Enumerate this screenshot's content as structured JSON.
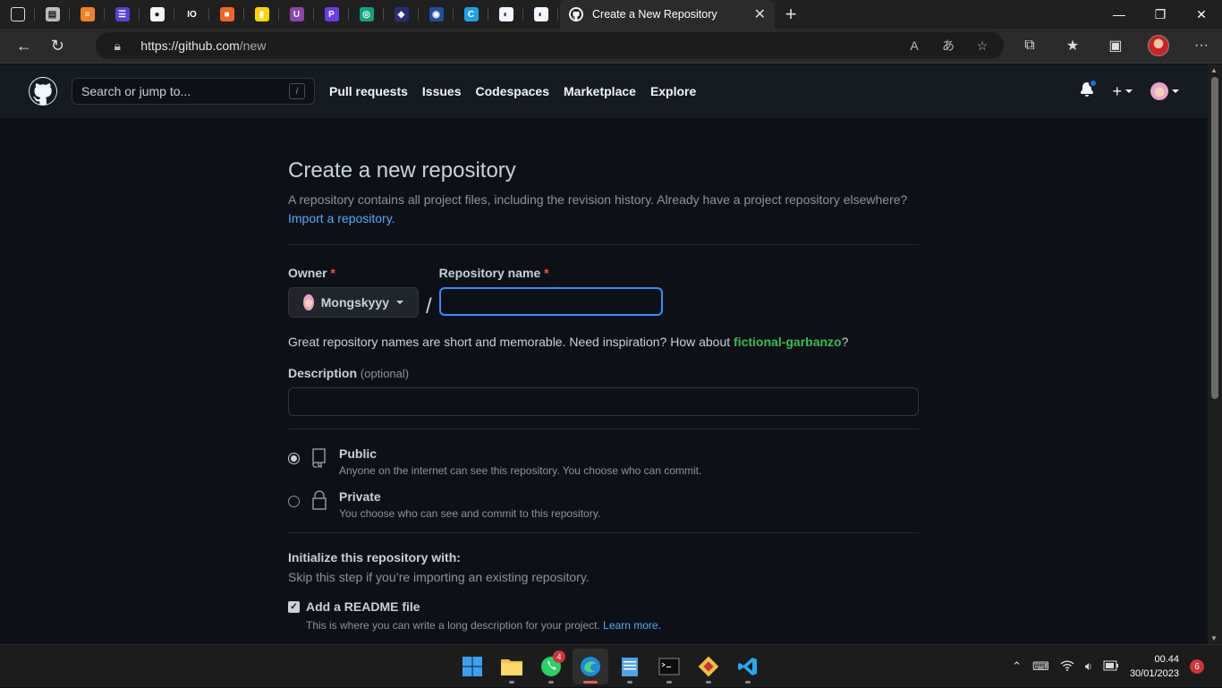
{
  "browser": {
    "tab_favicons": [
      {
        "name": "tab-actions-icon",
        "color": "#3a3a3a",
        "glyph": "▢"
      },
      {
        "name": "notepad-tab-icon",
        "color": "#bdbdbd",
        "glyph": "▤"
      },
      {
        "name": "stackoverflow-tab-icon",
        "color": "#f48024",
        "glyph": "≡"
      },
      {
        "name": "list-tab-icon",
        "color": "#5b3fd8",
        "glyph": "☰"
      },
      {
        "name": "circle-tab-icon",
        "color": "#f5f5f5",
        "glyph": "●"
      },
      {
        "name": "io-tab-icon",
        "color": "#202020",
        "glyph": "IO"
      },
      {
        "name": "orange-tab-icon",
        "color": "#f26522",
        "glyph": "■"
      },
      {
        "name": "flag-tab-icon",
        "color": "#ffd500",
        "glyph": "▮"
      },
      {
        "name": "purple-u-tab-icon",
        "color": "#8e44ad",
        "glyph": "U"
      },
      {
        "name": "p-tab-icon",
        "color": "#6c3ce9",
        "glyph": "P"
      },
      {
        "name": "openai-tab-icon",
        "color": "#10a37f",
        "glyph": "◎"
      },
      {
        "name": "dark-tab-icon",
        "color": "#2a2a7a",
        "glyph": "◆"
      },
      {
        "name": "blue-tab-icon",
        "color": "#1e4fa0",
        "glyph": "◉"
      },
      {
        "name": "c-tab-icon",
        "color": "#1aa3e8",
        "glyph": "C"
      },
      {
        "name": "github-tab-icon-1",
        "color": "#f0f6fc",
        "glyph": "◐"
      },
      {
        "name": "github-tab-icon-2",
        "color": "#f0f6fc",
        "glyph": "◐"
      }
    ],
    "active_tab_title": "Create a New Repository",
    "url_host": "https://github.com",
    "url_path": "/new"
  },
  "github": {
    "search_placeholder": "Search or jump to...",
    "search_shortcut": "/",
    "nav": [
      "Pull requests",
      "Issues",
      "Codespaces",
      "Marketplace",
      "Explore"
    ]
  },
  "form": {
    "title": "Create a new repository",
    "subtitle": "A repository contains all project files, including the revision history. Already have a project repository elsewhere?",
    "import_link": "Import a repository.",
    "owner_label": "Owner",
    "required_mark": "*",
    "owner_value": "Mongskyyy",
    "slash": "/",
    "repo_name_label": "Repository name",
    "repo_name_value": "",
    "hint_prefix": "Great repository names are short and memorable. Need inspiration? How about ",
    "hint_suggestion": "fictional-garbanzo",
    "hint_suffix": "?",
    "description_label": "Description",
    "description_optional": "(optional)",
    "description_value": "",
    "visibility": [
      {
        "title": "Public",
        "desc": "Anyone on the internet can see this repository. You choose who can commit.",
        "checked": true
      },
      {
        "title": "Private",
        "desc": "You choose who can see and commit to this repository.",
        "checked": false
      }
    ],
    "init_title": "Initialize this repository with:",
    "init_sub": "Skip this step if you’re importing an existing repository.",
    "readme_label": "Add a README file",
    "readme_checked": true,
    "readme_desc": "This is where you can write a long description for your project.",
    "readme_learn_more": "Learn more."
  },
  "taskbar": {
    "whatsapp_badge": "4",
    "clock_time": "00.44",
    "clock_date": "30/01/2023",
    "notification_count": "6"
  },
  "colors": {
    "accent_blue": "#58a6ff",
    "suggestion_green": "#3fb950",
    "required_red": "#f85149",
    "page_bg": "#0d1117",
    "header_bg": "#161b22"
  }
}
